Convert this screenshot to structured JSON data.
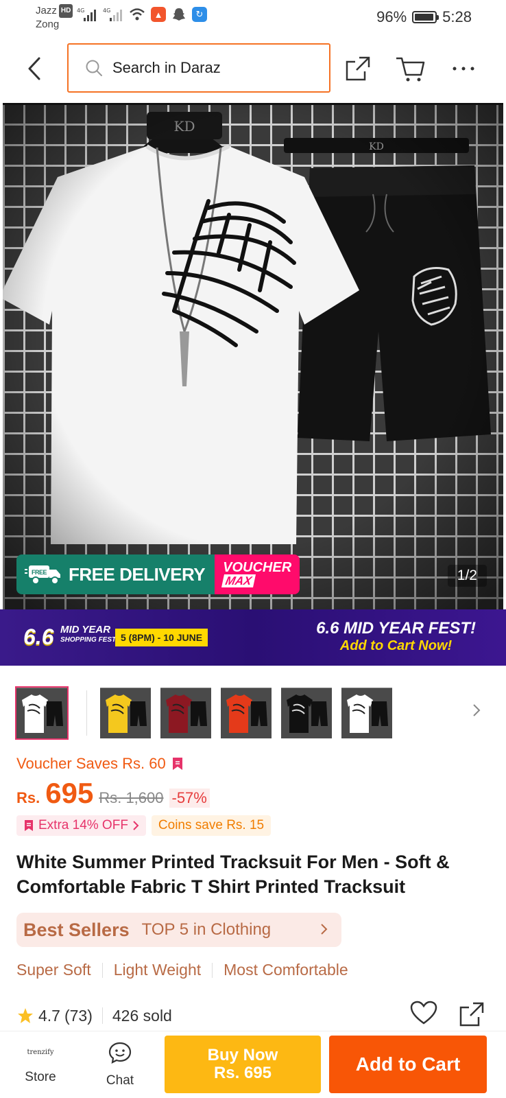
{
  "status_bar": {
    "carrier_line1": "Jazz",
    "hd_badge": "HD",
    "carrier_line2": "Zong",
    "battery_percent": "96%",
    "battery_level": 0.96,
    "time": "5:28"
  },
  "top_nav": {
    "search_placeholder": "Search in Daraz"
  },
  "hero": {
    "badge_free_delivery": "FREE DELIVERY",
    "badge_free_small": "FREE",
    "badge_voucher_line1": "VOUCHER",
    "badge_voucher_line2": "MAX",
    "hanger_brand": "KD",
    "page_indicator": "1/2"
  },
  "promo_banner": {
    "big": "6.6",
    "mid_line1": "MID YEAR",
    "mid_line2": "SHOPPING FEST!",
    "date": "5 (8PM) - 10 JUNE",
    "right_line1": "6.6 MID YEAR FEST!",
    "right_line2": "Add to Cart Now!"
  },
  "thumbnails": [
    {
      "shirt": "#ffffff",
      "shorts": "#111111"
    },
    {
      "shirt": "#f4c81e",
      "shorts": "#111111"
    },
    {
      "shirt": "#8c1822",
      "shorts": "#111111"
    },
    {
      "shirt": "#e43a1a",
      "shorts": "#111111"
    },
    {
      "shirt": "#111111",
      "shorts": "#111111"
    },
    {
      "shirt": "#ffffff",
      "shorts": "#111111"
    }
  ],
  "pricing": {
    "voucher_saves": "Voucher Saves Rs. 60",
    "currency": "Rs.",
    "price": "695",
    "original_price": "Rs. 1,600",
    "discount": "-57%",
    "extra_off": "Extra 14% OFF",
    "coins": "Coins save Rs. 15"
  },
  "product": {
    "title": "White Summer Printed Tracksuit For Men - Soft & Comfortable Fabric T Shirt Printed Tracksuit",
    "best_sellers_label": "Best Sellers",
    "best_sellers_rank": "TOP 5 in Clothing",
    "features": [
      "Super Soft",
      "Light Weight",
      "Most Comfortable"
    ],
    "rating": "4.7",
    "rating_count": "(73)",
    "sold": "426 sold"
  },
  "bottom_bar": {
    "store_logo": "trenzify",
    "store_label": "Store",
    "chat_label": "Chat",
    "buy_now_line1": "Buy Now",
    "buy_now_line2": "Rs. 695",
    "add_to_cart": "Add to Cart"
  },
  "colors": {
    "accent": "#f57224",
    "price": "#f05a12",
    "buy_now": "#fdb813",
    "add_to_cart": "#f85606",
    "free_delivery": "#16806a",
    "voucher": "#ff0b6b",
    "banner": "#2a0f74"
  }
}
